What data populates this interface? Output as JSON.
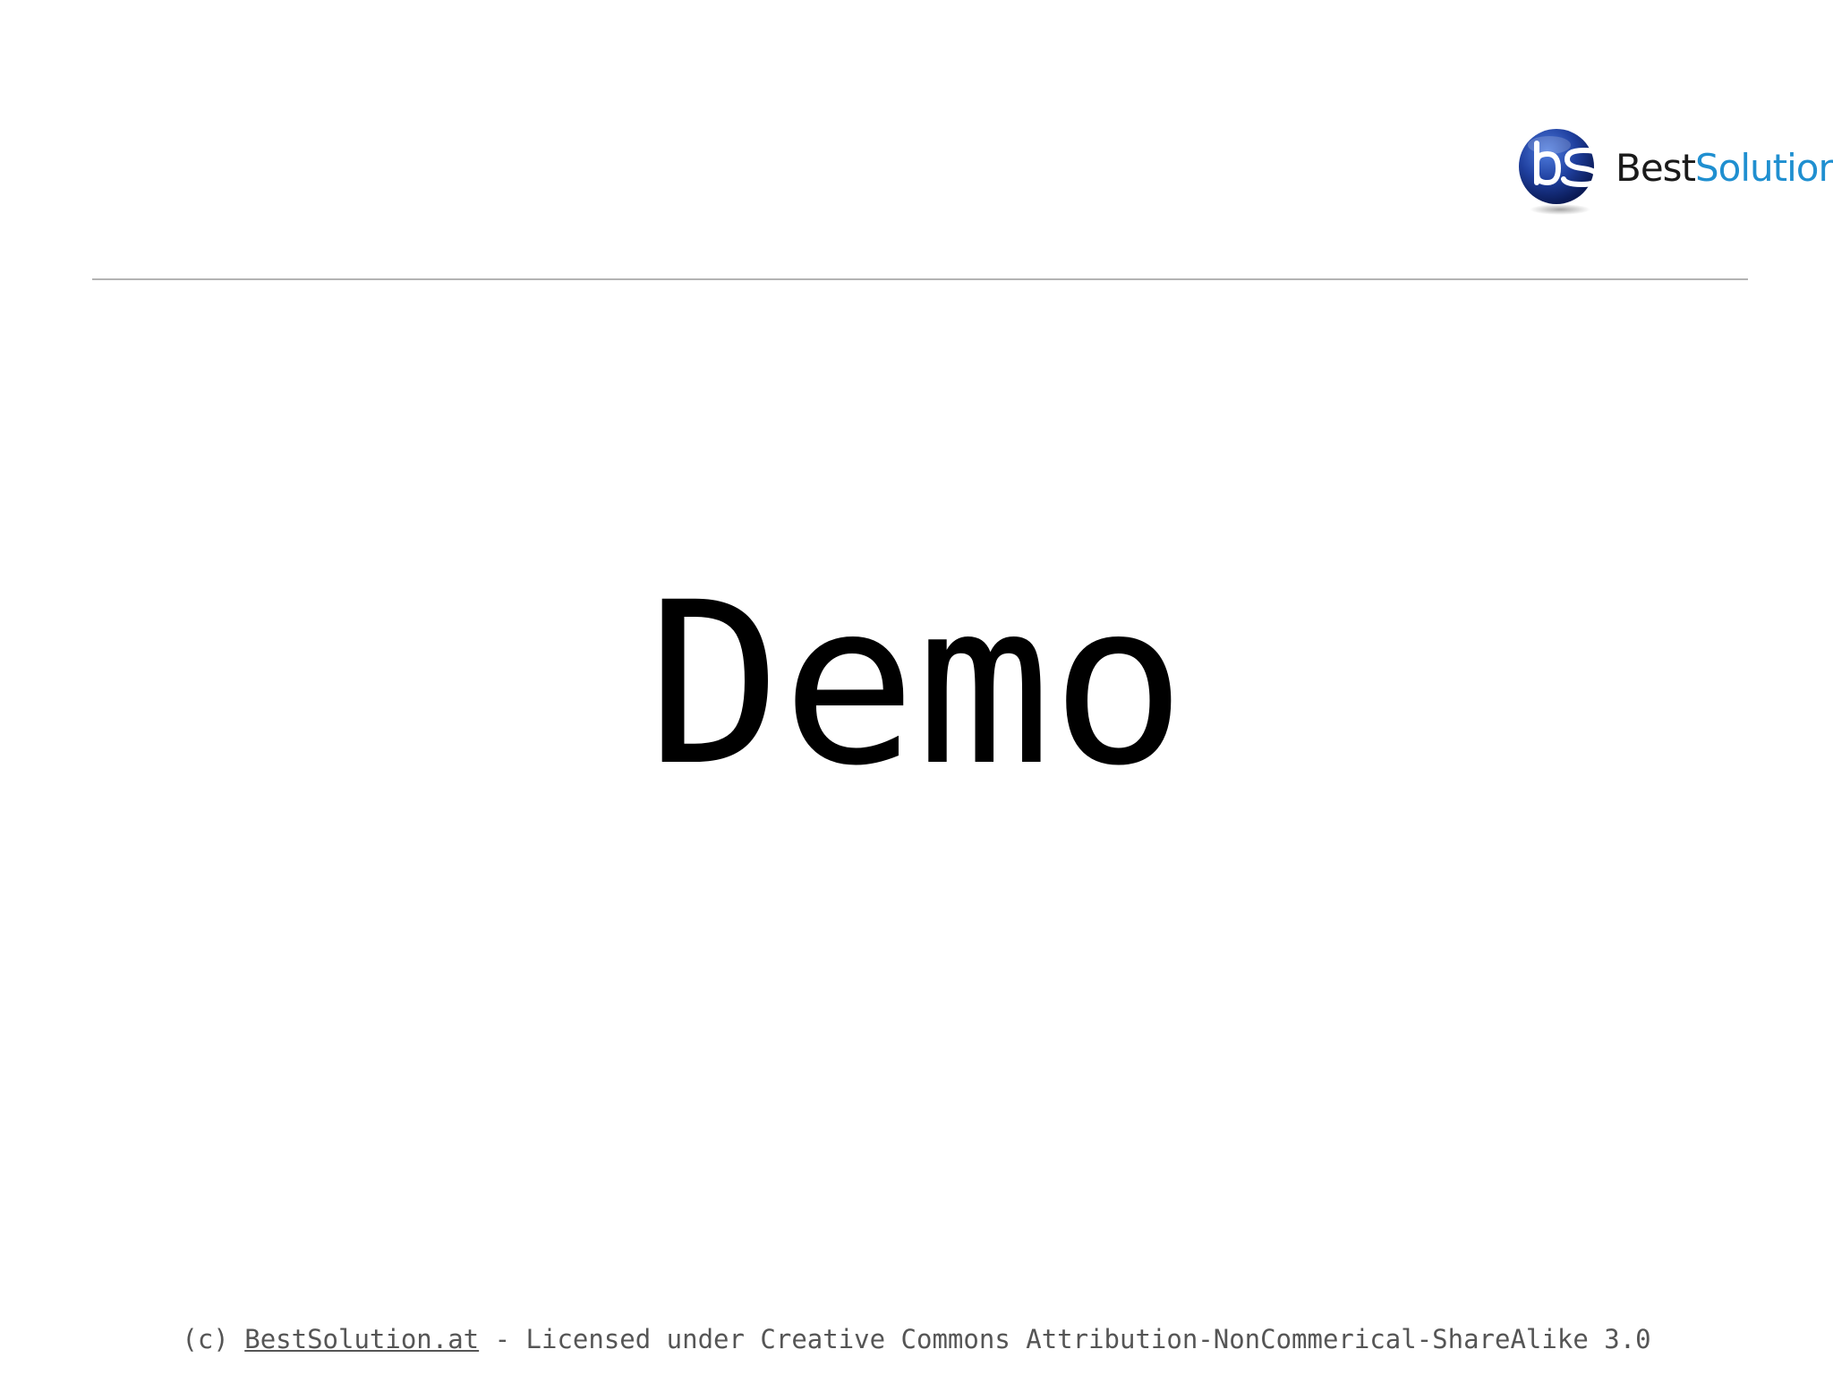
{
  "logo": {
    "mark_letters": "bs",
    "word_part1": "Best",
    "word_part2": "Solution",
    "colors": {
      "globe": "#1f3f9e",
      "word_part1": "#1a1a1a",
      "word_part2": "#1f8fd0"
    }
  },
  "slide": {
    "title": "Demo"
  },
  "footer": {
    "prefix": "(c)",
    "link_text": "BestSolution.at",
    "suffix": "- Licensed under Creative Commons Attribution-NonCommerical-ShareAlike 3.0"
  }
}
